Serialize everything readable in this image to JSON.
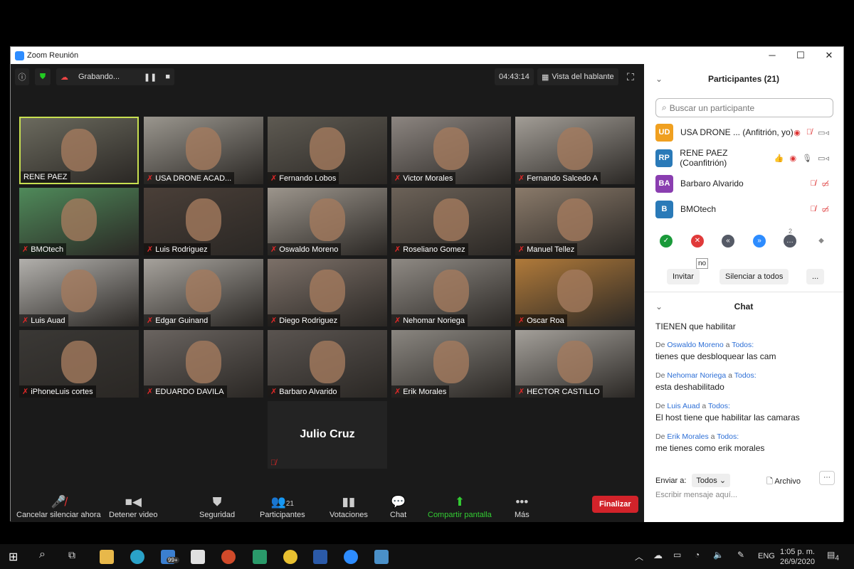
{
  "window": {
    "title": "Zoom Reunión",
    "min": "─",
    "max": "☐",
    "close": "✕"
  },
  "topbar": {
    "recording": "Grabando...",
    "timer": "04:43:14",
    "view": "Vista del hablante"
  },
  "tiles": [
    {
      "name": "RENE PAEZ",
      "muted": false,
      "active": true,
      "color": "#6b6a5e"
    },
    {
      "name": "USA DRONE ACAD...",
      "muted": true,
      "color": "#9a968e"
    },
    {
      "name": "Fernando Lobos",
      "muted": true,
      "color": "#5e5a52"
    },
    {
      "name": "Victor Morales",
      "muted": true,
      "color": "#8c8580"
    },
    {
      "name": "Fernando Salcedo A",
      "muted": true,
      "color": "#a29d96"
    },
    {
      "name": "BMOtech",
      "muted": true,
      "color": "#4f8a5a"
    },
    {
      "name": "Luis Rodriguez",
      "muted": true,
      "color": "#4a3f38"
    },
    {
      "name": "Oswaldo Moreno",
      "muted": true,
      "color": "#9c958c"
    },
    {
      "name": "Roseliano Gomez",
      "muted": true,
      "color": "#6c6258"
    },
    {
      "name": "Manuel Tellez",
      "muted": true,
      "color": "#8a7a6a"
    },
    {
      "name": "Luis Auad",
      "muted": true,
      "color": "#b2b0ac"
    },
    {
      "name": "Edgar Guinand",
      "muted": true,
      "color": "#a6a29c"
    },
    {
      "name": "Diego Rodriguez",
      "muted": true,
      "color": "#7c7068"
    },
    {
      "name": "Nehomar Noriega",
      "muted": true,
      "color": "#8f8a84"
    },
    {
      "name": "Oscar Roa",
      "muted": true,
      "color": "#b07a3a"
    },
    {
      "name": "iPhoneLuis cortes",
      "muted": true,
      "color": "#3a3835"
    },
    {
      "name": "EDUARDO DAVILA",
      "muted": true,
      "color": "#6a6460"
    },
    {
      "name": "Barbaro Alvarido",
      "muted": true,
      "color": "#5a5450"
    },
    {
      "name": "Erik Morales",
      "muted": true,
      "color": "#8a8680"
    },
    {
      "name": "HECTOR CASTILLO",
      "muted": true,
      "color": "#a4a09a"
    }
  ],
  "nocam_tile": {
    "name": "Julio Cruz"
  },
  "toolbar": {
    "unmute": "Cancelar silenciar ahora",
    "video": "Detener video",
    "security": "Seguridad",
    "participants": "Participantes",
    "participants_count": "21",
    "polls": "Votaciones",
    "chat": "Chat",
    "share": "Compartir pantalla",
    "more": "Más",
    "end": "Finalizar"
  },
  "panel": {
    "title": "Participantes (21)",
    "search_placeholder": "Buscar un participante",
    "participants": [
      {
        "initials": "UD",
        "name": "USA DRONE ...  (Anfitrión, yo)",
        "color": "#f0a020"
      },
      {
        "initials": "RP",
        "name": "RENE PAEZ (Coanfitrión)",
        "color": "#2a7ab8"
      },
      {
        "initials": "BA",
        "name": "Barbaro Alvarido",
        "color": "#8a3eb0"
      },
      {
        "initials": "B",
        "name": "BMOtech",
        "color": "#2a7ab8"
      }
    ],
    "reaction_count": "2",
    "tooltip": "no",
    "invite": "Invitar",
    "mute_all": "Silenciar a todos",
    "more": "..."
  },
  "chat": {
    "title": "Chat",
    "first": "TIENEN que habilitar",
    "from": "De",
    "to": "a",
    "all": "Todos:",
    "messages": [
      {
        "sender": "Oswaldo Moreno",
        "text": "tienes que desbloquear las cam"
      },
      {
        "sender": "Nehomar Noriega",
        "text": "esta deshabilitado"
      },
      {
        "sender": "Luis Auad",
        "text": "El host tiene que habilitar las camaras"
      },
      {
        "sender": "Erik Morales",
        "text": "me tienes como erik morales"
      }
    ],
    "send_to": "Enviar a:",
    "recipient": "Todos",
    "file": "Archivo",
    "placeholder": "Escribir mensaje aquí..."
  },
  "taskbar": {
    "time": "1:05 p. m.",
    "date": "26/9/2020",
    "lang": "ENG",
    "mail_badge": "99+",
    "notif": "4"
  }
}
